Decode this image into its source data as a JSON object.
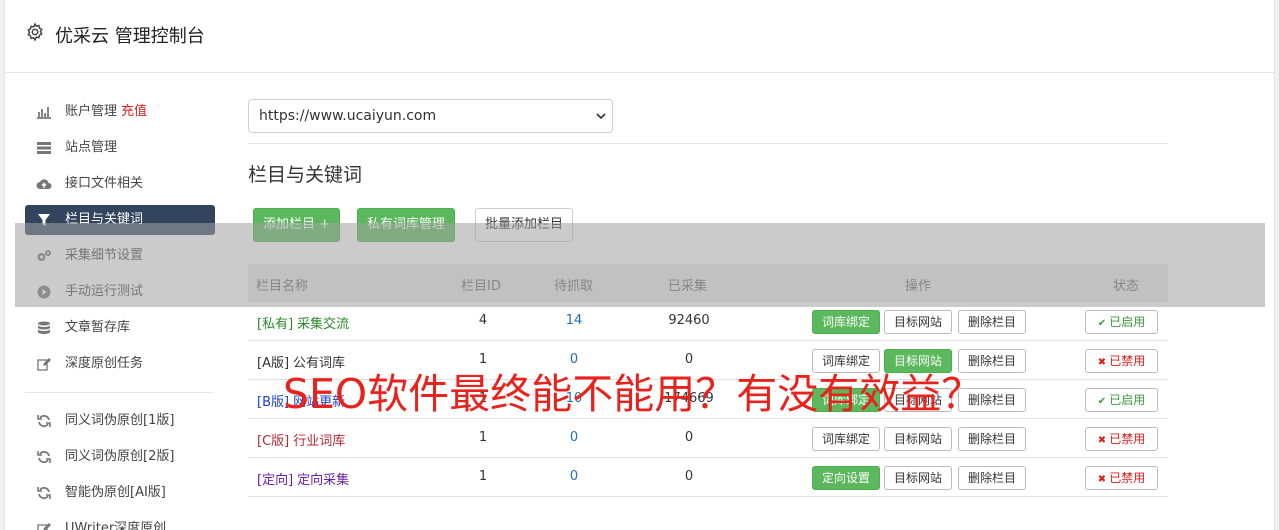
{
  "header": {
    "title": "优采云 管理控制台"
  },
  "sidebar": {
    "items": [
      {
        "label": "账户管理",
        "icon": "bar-chart-icon",
        "extra": "充值"
      },
      {
        "label": "站点管理",
        "icon": "server-icon"
      },
      {
        "label": "接口文件相关",
        "icon": "cloud-upload-icon"
      },
      {
        "label": "栏目与关键词",
        "icon": "filter-icon",
        "active": true
      },
      {
        "label": "采集细节设置",
        "icon": "gears-icon"
      },
      {
        "label": "手动运行测试",
        "icon": "play-circle-icon"
      },
      {
        "label": "文章暂存库",
        "icon": "database-icon"
      },
      {
        "label": "深度原创任务",
        "icon": "edit-icon"
      }
    ],
    "items2": [
      {
        "label": "同义词伪原创[1版]",
        "icon": "refresh-icon"
      },
      {
        "label": "同义词伪原创[2版]",
        "icon": "refresh-icon"
      },
      {
        "label": "智能伪原创[AI版]",
        "icon": "refresh-icon"
      },
      {
        "label": "UWriter深度原创",
        "icon": "edit-icon"
      }
    ]
  },
  "main": {
    "site_select": "https://www.ucaiyun.com",
    "section_title": "栏目与关键词",
    "buttons": {
      "add_column": "添加栏目 +",
      "private_lib": "私有词库管理",
      "batch_add": "批量添加栏目"
    },
    "table": {
      "headers": [
        "栏目名称",
        "栏目ID",
        "待抓取",
        "已采集",
        "操作",
        "状态"
      ],
      "rows": [
        {
          "tag": "[私有]",
          "name": "采集交流",
          "color": "#2a8a2a",
          "id": "4",
          "pending": "14",
          "collected": "92460",
          "op1": "词库绑定",
          "op1_green": true,
          "op2": "目标网站",
          "op2_green": false,
          "op3": "删除栏目",
          "status": "已启用",
          "enabled": true
        },
        {
          "tag": "[A版]",
          "name": "公有词库",
          "color": "#333333",
          "id": "1",
          "pending": "0",
          "collected": "0",
          "op1": "词库绑定",
          "op1_green": false,
          "op2": "目标网站",
          "op2_green": true,
          "op3": "删除栏目",
          "status": "已禁用",
          "enabled": false
        },
        {
          "tag": "[B版]",
          "name": "网站更新",
          "color": "#1f3fc4",
          "id": "1",
          "pending": "10",
          "collected": "174669",
          "op1": "词库绑定",
          "op1_green": true,
          "op2": "目标网站",
          "op2_green": false,
          "op3": "删除栏目",
          "status": "已启用",
          "enabled": true
        },
        {
          "tag": "[C版]",
          "name": "行业词库",
          "color": "#b52a3a",
          "id": "1",
          "pending": "0",
          "collected": "0",
          "op1": "词库绑定",
          "op1_green": false,
          "op2": "目标网站",
          "op2_green": false,
          "op3": "删除栏目",
          "status": "已禁用",
          "enabled": false
        },
        {
          "tag": "[定向]",
          "name": "定向采集",
          "color": "#6a1fb0",
          "id": "1",
          "pending": "0",
          "collected": "0",
          "op1": "定向设置",
          "op1_green": true,
          "op2": "目标网站",
          "op2_green": false,
          "op3": "删除栏目",
          "status": "已禁用",
          "enabled": false
        }
      ]
    }
  },
  "watermark": "SEO软件最终能不能用？有没有效益？",
  "colors": {
    "sidebar_active": "#33455e",
    "success": "#5cb85c",
    "danger": "#d9201e",
    "link": "#1f6fb5"
  }
}
